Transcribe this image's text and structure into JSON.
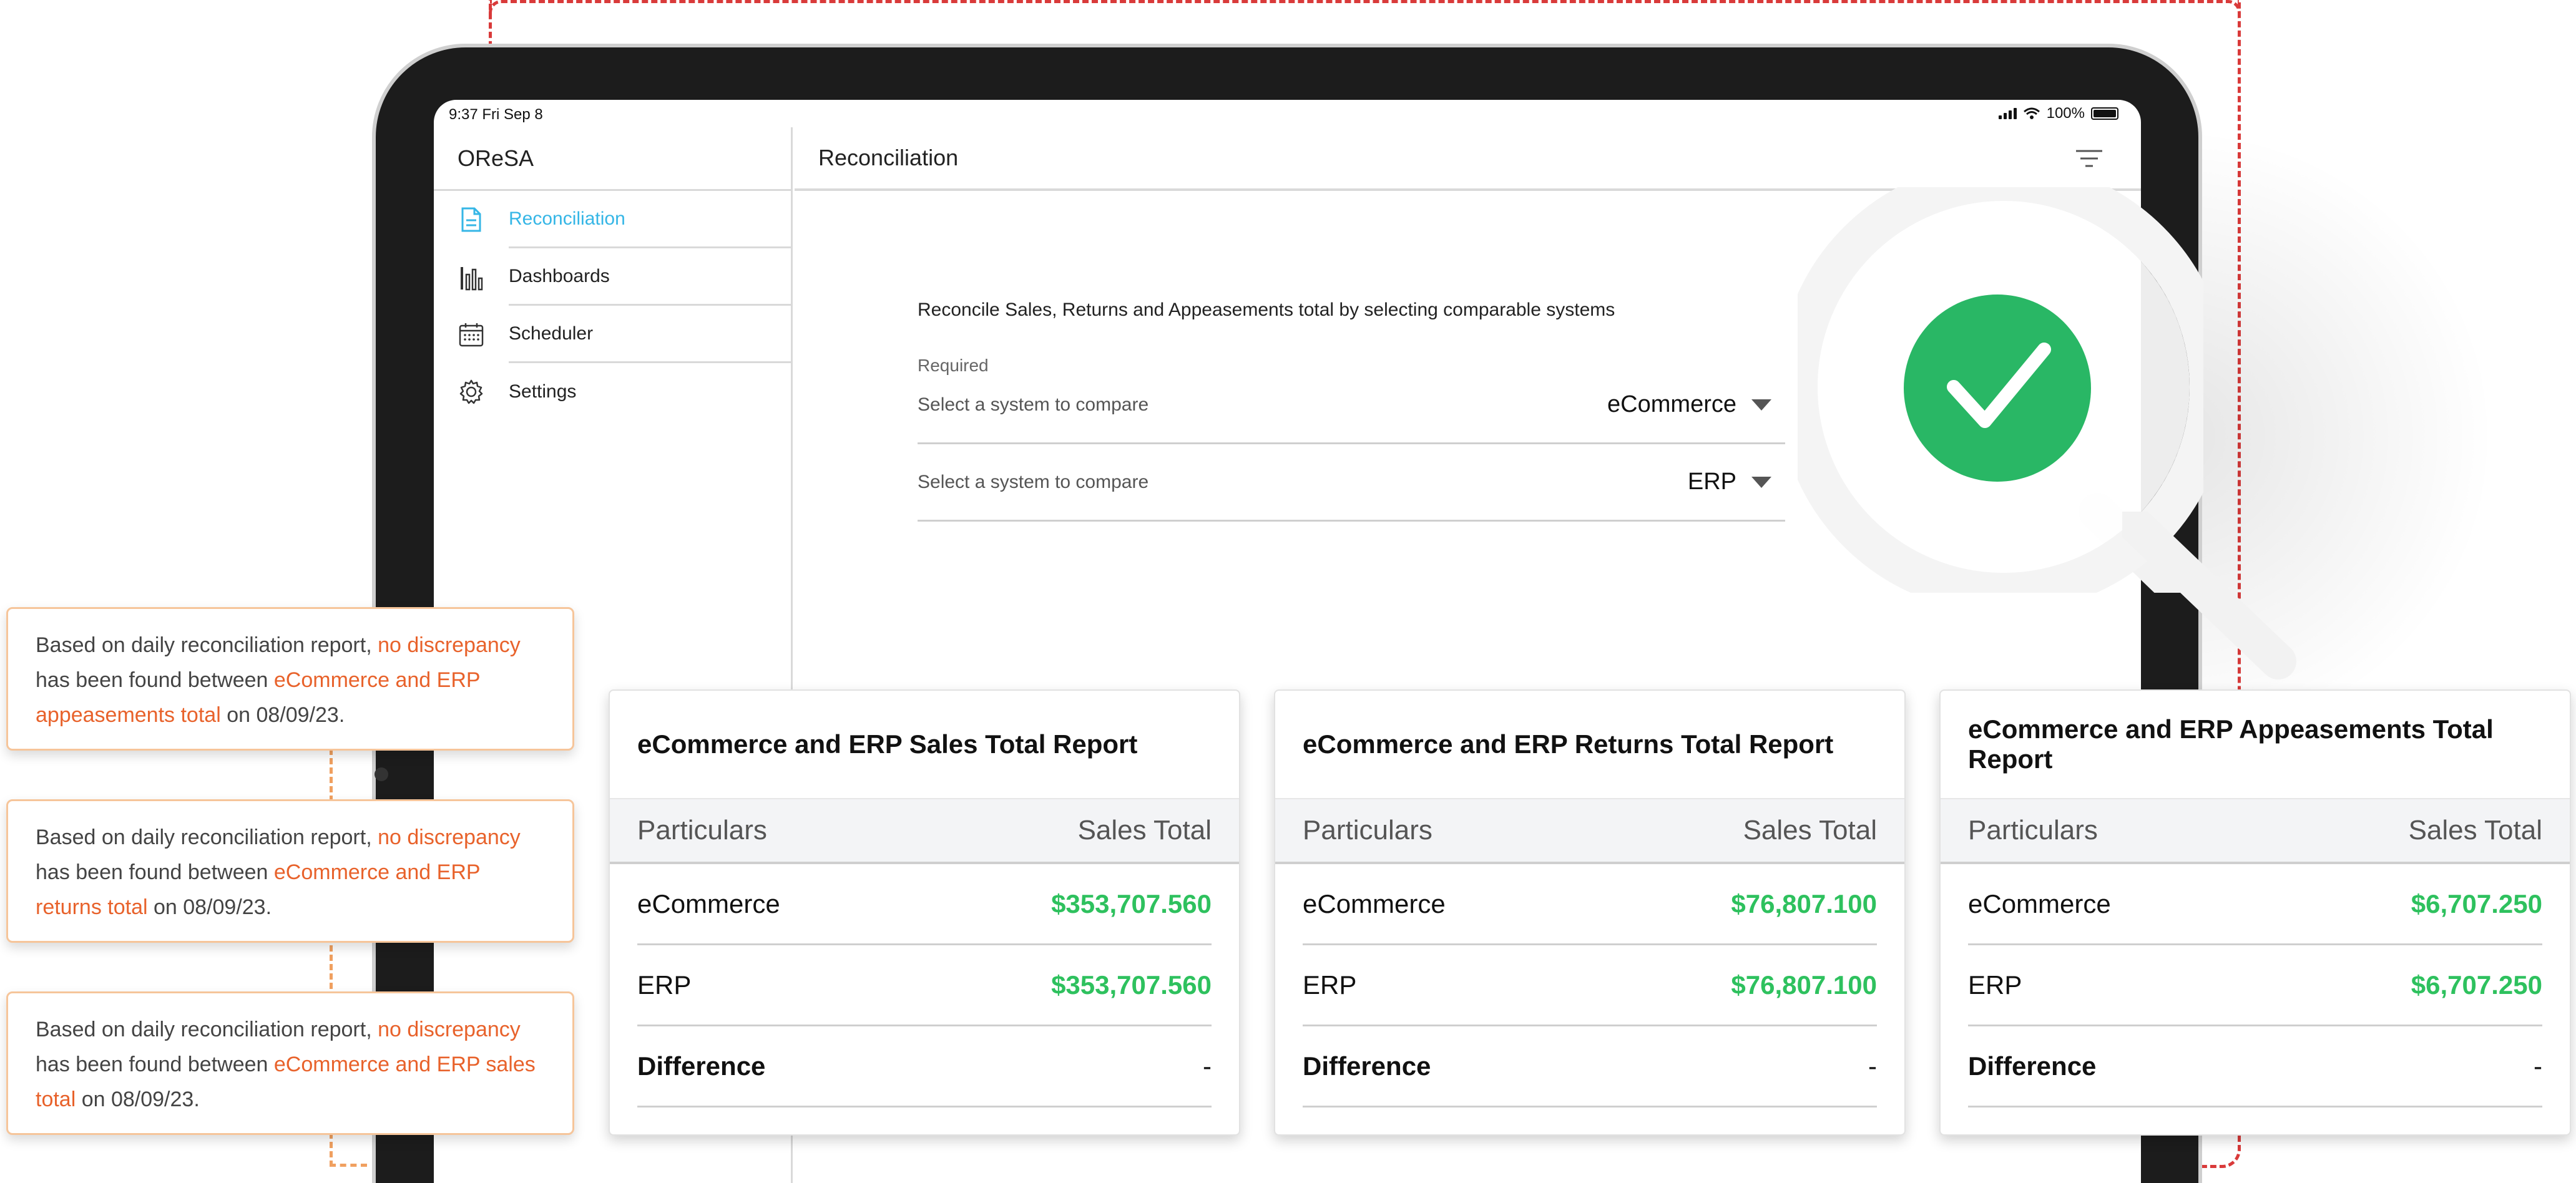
{
  "status_bar": {
    "time": "9:37  Fri Sep 8",
    "battery": "100%"
  },
  "app": {
    "name": "OReSA"
  },
  "sidebar": {
    "items": [
      {
        "label": "Reconciliation",
        "icon": "document-icon",
        "active": true
      },
      {
        "label": "Dashboards",
        "icon": "bar-chart-icon",
        "active": false
      },
      {
        "label": "Scheduler",
        "icon": "calendar-icon",
        "active": false
      },
      {
        "label": "Settings",
        "icon": "gear-icon",
        "active": false
      }
    ]
  },
  "header": {
    "title": "Reconciliation"
  },
  "form": {
    "intro": "Reconcile Sales, Returns and Appeasements total by selecting comparable systems",
    "required": "Required",
    "rows": [
      {
        "label": "Select a system to compare",
        "value": "eCommerce"
      },
      {
        "label": "Select a system to compare",
        "value": "ERP"
      }
    ]
  },
  "notes": [
    {
      "prefix": "Based on daily reconciliation report, ",
      "hl1": "no discrepancy",
      "mid": " has been found between ",
      "hl2": "eCommerce and ERP appeasements total",
      "suffix": " on 08/09/23."
    },
    {
      "prefix": "Based on daily reconciliation report, ",
      "hl1": "no discrepancy",
      "mid": " has been found between ",
      "hl2": "eCommerce and ERP returns total",
      "suffix": " on 08/09/23."
    },
    {
      "prefix": "Based on daily reconciliation report, ",
      "hl1": "no discrepancy",
      "mid": " has been found between ",
      "hl2": "eCommerce and ERP sales total",
      "suffix": " on 08/09/23."
    }
  ],
  "reports": [
    {
      "title": "eCommerce and ERP Sales Total Report",
      "col1": "Particulars",
      "col2": "Sales Total",
      "rows": [
        {
          "label": "eCommerce",
          "value": "$353,707.560"
        },
        {
          "label": "ERP",
          "value": "$353,707.560"
        },
        {
          "label": "Difference",
          "value": "-"
        }
      ]
    },
    {
      "title": "eCommerce and ERP Returns Total Report",
      "col1": "Particulars",
      "col2": "Sales Total",
      "rows": [
        {
          "label": "eCommerce",
          "value": "$76,807.100"
        },
        {
          "label": "ERP",
          "value": "$76,807.100"
        },
        {
          "label": "Difference",
          "value": "-"
        }
      ]
    },
    {
      "title": "eCommerce and ERP Appeasements Total Report",
      "col1": "Particulars",
      "col2": "Sales Total",
      "rows": [
        {
          "label": "eCommerce",
          "value": "$6,707.250"
        },
        {
          "label": "ERP",
          "value": "$6,707.250"
        },
        {
          "label": "Difference",
          "value": "-"
        }
      ]
    }
  ],
  "colors": {
    "accent": "#35b6e6",
    "highlight": "#e8622b",
    "positive": "#2ec15e",
    "check_badge": "#29b765",
    "dash_red": "#d93a3a",
    "dash_orange": "#f0a060"
  }
}
